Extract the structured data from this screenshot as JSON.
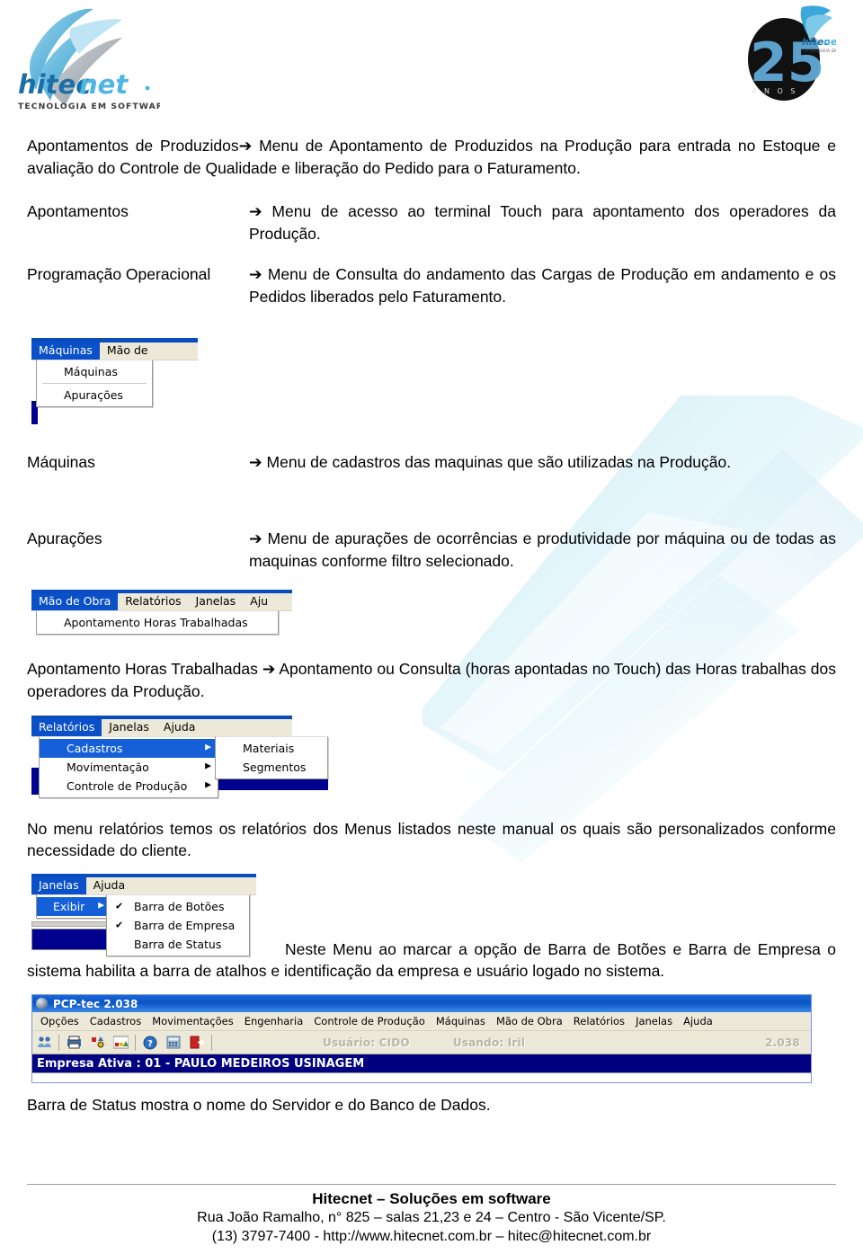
{
  "header": {
    "logo_text": "hitecnet",
    "logo_tagline": "TECNOLOGIA EM SOFTWARE",
    "anniversary_number": "25",
    "anniversary_label": "A N O S",
    "anniversary_logo_text": "hitecnet"
  },
  "definitions": [
    {
      "term": "Apontamentos de Produzidos",
      "arrow": "➔",
      "desc": "Menu de Apontamento de Produzidos na Produção para entrada no Estoque e avaliação do Controle de Qualidade e liberação do Pedido para o Faturamento."
    },
    {
      "term": "Apontamentos",
      "arrow": "➔",
      "desc": "Menu de acesso ao terminal Touch para apontamento dos operadores da Produção."
    },
    {
      "term": "Programação Operacional",
      "arrow": "➔",
      "desc": "Menu de Consulta do andamento das Cargas de Produção em andamento e os Pedidos liberados pelo Faturamento."
    },
    {
      "term": "Máquinas",
      "arrow": "➔",
      "desc": "Menu de cadastros das maquinas que são utilizadas na Produção."
    },
    {
      "term": "Apurações",
      "arrow": "➔",
      "desc": "Menu de apurações de ocorrências e produtividade por máquina ou de todas as maquinas conforme filtro selecionado."
    }
  ],
  "screenshot_maquinas": {
    "menubar": [
      {
        "label": "Máquinas",
        "selected": true
      },
      {
        "label": "Mão de",
        "selected": false
      }
    ],
    "dropdown": [
      {
        "label": "Máquinas"
      },
      {
        "label": "Apurações"
      }
    ]
  },
  "screenshot_mao_de_obra": {
    "menubar": [
      {
        "label": "Mão de Obra",
        "selected": true
      },
      {
        "label": "Relatórios",
        "selected": false
      },
      {
        "label": "Janelas",
        "selected": false
      },
      {
        "label": "Aju",
        "selected": false
      }
    ],
    "dropdown": [
      {
        "label": "Apontamento Horas Trabalhadas"
      }
    ]
  },
  "apontamento_horas": {
    "term": "Apontamento Horas Trabalhadas",
    "arrow": "➔",
    "desc": "Apontamento ou Consulta (horas apontadas no Touch) das Horas trabalhas dos operadores da Produção."
  },
  "screenshot_relatorios": {
    "menubar": [
      {
        "label": "Relatórios",
        "selected": true
      },
      {
        "label": "Janelas",
        "selected": false
      },
      {
        "label": "Ajuda",
        "selected": false
      }
    ],
    "dropdown": [
      {
        "label": "Cadastros",
        "selected": true,
        "submenu": true
      },
      {
        "label": "Movimentação",
        "selected": false,
        "submenu": true
      },
      {
        "label": "Controle de Produção",
        "selected": false,
        "submenu": true
      }
    ],
    "submenu": [
      {
        "label": "Materiais"
      },
      {
        "label": "Segmentos"
      }
    ]
  },
  "paragraph_relatorios": "No menu relatórios temos os relatórios dos Menus listados neste manual os quais são personalizados conforme necessidade do cliente.",
  "screenshot_janelas": {
    "menubar": [
      {
        "label": "Janelas",
        "selected": true
      },
      {
        "label": "Ajuda",
        "selected": false
      }
    ],
    "dropdown": [
      {
        "label": "Exibir",
        "selected": true,
        "submenu": true
      }
    ],
    "submenu": [
      {
        "label": "Barra de Botões",
        "checked": true
      },
      {
        "label": "Barra de Empresa",
        "checked": true
      },
      {
        "label": "Barra de Status",
        "checked": false
      }
    ]
  },
  "paragraph_janelas": "Neste Menu ao marcar a opção de Barra de Botões e Barra de Empresa o sistema habilita a barra de atalhos e identificação da empresa e usuário logado no sistema.",
  "app_window": {
    "title": "PCP-tec 2.038",
    "menu": [
      "Opções",
      "Cadastros",
      "Movimentações",
      "Engenharia",
      "Controle de Produção",
      "Máquinas",
      "Mão de Obra",
      "Relatórios",
      "Janelas",
      "Ajuda"
    ],
    "toolbar_icons": [
      "users-icon",
      "printer-icon",
      "chart-icon",
      "report-icon",
      "help-icon",
      "calculator-icon",
      "exit-icon"
    ],
    "user_label": "Usuário: CIDO",
    "using_label": "Usando: Iril",
    "version": "2.038",
    "empresa_bar": "Empresa Ativa : 01 - PAULO MEDEIROS USINAGEM"
  },
  "status_note": "Barra de Status mostra o nome do Servidor e do Banco de Dados.",
  "footer": {
    "line1": "Hitecnet – Soluções em software",
    "line2": "Rua João Ramalho, n° 825 – salas 21,23 e 24 – Centro - São Vicente/SP.",
    "line3": "(13) 3797-7400 - http://www.hitecnet.com.br – hitec@hitecnet.com.br"
  },
  "colors": {
    "menu_highlight": "#0a50c8",
    "submenu_highlight": "#1560d8",
    "menubar_bg": "#ece9d8",
    "navy": "#000080",
    "titlebar_blue": "#0a54c4",
    "brand_blue": "#2ba6de"
  }
}
